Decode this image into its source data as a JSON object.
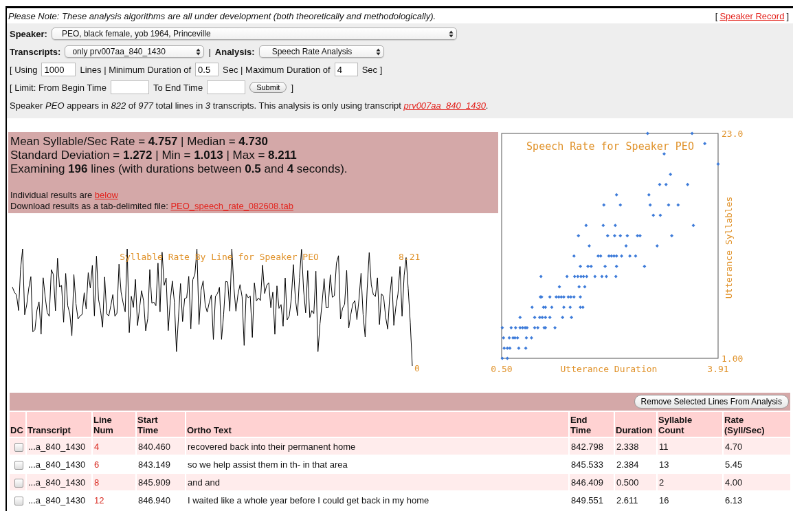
{
  "notice": {
    "text": "Please Note: These analysis algorithms are all under development (both theoretically and methodologically).",
    "open": "[",
    "link": "Speaker Record",
    "close": "]"
  },
  "speaker": {
    "label": "Speaker:",
    "value": "PEO, black female, yob 1964, Princeville"
  },
  "transcripts": {
    "label": "Transcripts:",
    "value": "only prv007aa_840_1430"
  },
  "separator": "|",
  "analysis": {
    "label": "Analysis:",
    "value": "Speech Rate Analysis"
  },
  "settings_line": [
    {
      "kind": "text",
      "text": "[ Using"
    },
    {
      "kind": "field",
      "value": "1000"
    },
    {
      "kind": "text",
      "text": "Lines | Minimum Duration of"
    },
    {
      "kind": "field",
      "value": "0.5"
    },
    {
      "kind": "text",
      "text": "Sec | Maximum Duration of"
    },
    {
      "kind": "field",
      "value": "4"
    },
    {
      "kind": "text",
      "text": "Sec ]"
    }
  ],
  "limit_line": [
    {
      "kind": "text",
      "text": "[ Limit: From Begin Time"
    },
    {
      "kind": "field"
    },
    {
      "kind": "text",
      "text": "To End Time"
    },
    {
      "kind": "field"
    },
    {
      "kind": "button",
      "text": "Submit"
    },
    {
      "kind": "text",
      "text": "]"
    }
  ],
  "summary": {
    "text": "Speaker *PEO* appears in *822* of *977* total lines in *3* transcripts. This analysis is only using transcript ",
    "link": "prv007aa_840_1430",
    "after": "."
  },
  "stats": {
    "lines": [
      "Mean Syllable/Sec Rate = **4.757** | Median = **4.730**",
      "Standard Deviation = **1.272** | Min = **1.013** | Max = **8.211**",
      "Examining **196** lines (with durations between **0.5** and **4** seconds)."
    ],
    "results_note": {
      "text": "Individual results are ",
      "link": "below"
    },
    "download": {
      "text": "Download results as a tab-delimited file: ",
      "link": "PEO_speech_rate_082608.tab"
    }
  },
  "rate_by_line": {
    "title": "Syllable Rate By Line for Speaker PEO",
    "max_label": "8.21",
    "min_label": "0"
  },
  "scatter": {
    "chart_data": {
      "type": "scatter",
      "title": "Speech Rate for Speaker PEO",
      "xlabel": "Utterance Duration",
      "ylabel": "Utterance Syllables",
      "xlim": [
        0.5,
        3.91
      ],
      "ylim": [
        1,
        23
      ],
      "xticks": [
        {
          "value": 0.5,
          "label": "0.50"
        },
        {
          "value": 3.91,
          "label": "3.91"
        }
      ],
      "yticks": [
        {
          "value": 1,
          "label": "1.00"
        },
        {
          "value": 23,
          "label": "23.0"
        }
      ],
      "x": [
        0.51,
        0.59,
        0.54,
        0.59,
        0.63,
        0.77,
        0.88,
        0.53,
        0.62,
        0.68,
        0.71,
        0.75,
        0.89,
        0.97,
        0.51,
        0.65,
        0.72,
        0.79,
        0.83,
        0.87,
        0.9,
        1.02,
        1.07,
        1.17,
        1.19,
        1.34,
        0.79,
        1.02,
        1.1,
        1.14,
        1.19,
        1.26,
        1.46,
        1.6,
        0.98,
        1.16,
        1.19,
        1.29,
        1.48,
        1.58,
        1.74,
        1.78,
        1.11,
        1.13,
        1.26,
        1.36,
        1.4,
        1.44,
        1.48,
        1.55,
        1.59,
        1.64,
        1.74,
        1.41,
        1.72,
        1.81,
        1.12,
        1.53,
        1.65,
        1.7,
        1.75,
        1.79,
        1.84,
        1.97,
        2.08,
        2.15,
        2.3,
        1.74,
        1.86,
        1.91,
        2.13,
        2.31,
        2.75,
        1.64,
        2.02,
        2.06,
        2.19,
        2.23,
        2.27,
        2.31,
        2.39,
        2.52,
        2.61,
        1.88,
        2.46,
        2.95,
        1.71,
        2.17,
        2.28,
        2.37,
        2.48,
        2.64,
        2.68,
        3.18,
        1.83,
        2.1,
        2.29,
        3.52,
        2.89,
        3.0,
        2.11,
        2.37,
        2.84,
        3.13,
        3.28,
        2.31,
        2.82,
        2.99,
        3.09,
        3.43,
        3.16,
        3.91,
        3.06,
        3.7,
        2.8,
        3.5
      ],
      "series": [
        {
          "color": "#3d7bd9",
          "values": [
            1,
            1,
            2,
            2,
            2,
            2,
            2,
            3,
            3,
            3,
            3,
            3,
            3,
            3,
            4,
            4,
            4,
            4,
            4,
            4,
            4,
            4,
            4,
            4,
            4,
            4,
            5,
            5,
            5,
            5,
            5,
            5,
            5,
            5,
            6,
            6,
            6,
            6,
            6,
            6,
            6,
            6,
            7,
            7,
            7,
            7,
            7,
            7,
            7,
            7,
            7,
            7,
            7,
            8,
            8,
            8,
            9,
            9,
            9,
            9,
            9,
            9,
            9,
            9,
            9,
            9,
            9,
            10,
            10,
            10,
            10,
            10,
            10,
            11,
            11,
            11,
            11,
            11,
            11,
            11,
            11,
            11,
            11,
            12,
            12,
            12,
            13,
            13,
            13,
            13,
            13,
            13,
            13,
            13,
            14,
            14,
            14,
            14,
            15,
            15,
            16,
            16,
            16,
            16,
            16,
            17,
            17,
            18,
            18,
            18,
            19,
            20,
            21,
            22,
            23,
            23
          ]
        }
      ]
    }
  },
  "table": {
    "action_button": "Remove Selected Lines From Analysis",
    "columns": [
      {
        "kind": "check",
        "lines": [
          "DC"
        ]
      },
      {
        "kind": "text",
        "lines": [
          "Transcript"
        ]
      },
      {
        "kind": "link",
        "lines": [
          "Line",
          "Num"
        ]
      },
      {
        "kind": "text",
        "lines": [
          "Start",
          "Time"
        ]
      },
      {
        "kind": "text",
        "lines": [
          "Ortho Text"
        ]
      },
      {
        "kind": "text",
        "lines": [
          "End",
          "Time"
        ]
      },
      {
        "kind": "text",
        "lines": [
          "Duration"
        ]
      },
      {
        "kind": "text",
        "lines": [
          "Syllable",
          "Count"
        ]
      },
      {
        "kind": "text",
        "lines": [
          "Rate",
          "(Syll/Sec)"
        ]
      }
    ],
    "rows": [
      {
        "checked": false,
        "cells": [
          "",
          "...a_840_1430",
          "4",
          "840.460",
          "recovered back into their permanent home",
          "842.798",
          "2.338",
          "11",
          "4.70"
        ]
      },
      {
        "checked": false,
        "cells": [
          "",
          "...a_840_1430",
          "6",
          "843.149",
          "so we help assist them in th- in that area",
          "845.533",
          "2.384",
          "13",
          "5.45"
        ]
      },
      {
        "checked": false,
        "cells": [
          "",
          "...a_840_1430",
          "8",
          "845.909",
          "and and",
          "846.409",
          "0.500",
          "2",
          "4.00"
        ]
      },
      {
        "checked": false,
        "cells": [
          "",
          "...a_840_1430",
          "12",
          "846.940",
          "I waited like a whole year before I could get back in my home",
          "849.551",
          "2.611",
          "16",
          "6.13"
        ]
      }
    ]
  }
}
